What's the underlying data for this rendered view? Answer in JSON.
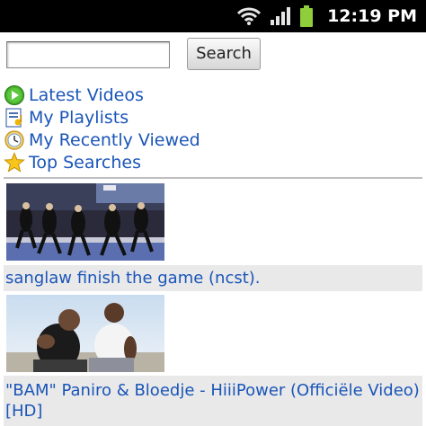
{
  "status_bar": {
    "time": "12:19 PM",
    "icons": [
      "wifi-icon",
      "signal-icon",
      "battery-icon"
    ],
    "battery_color": "#8fce3a"
  },
  "search": {
    "input_value": "",
    "placeholder": "",
    "button_label": "Search"
  },
  "nav_links": [
    {
      "label": "Latest Videos",
      "icon": "play-icon"
    },
    {
      "label": "My Playlists",
      "icon": "playlist-icon"
    },
    {
      "label": "My Recently Viewed",
      "icon": "clock-icon"
    },
    {
      "label": "Top Searches",
      "icon": "star-icon"
    }
  ],
  "videos": [
    {
      "title": "sanglaw finish the game (ncst)."
    },
    {
      "title": "\"BAM\" Paniro & Bloedje - HiiiPower (Officiële Video) [HD]"
    }
  ],
  "colors": {
    "link": "#1a55b8",
    "title_bar_bg": "#e9e9e9",
    "status_bar_bg": "#000000"
  }
}
